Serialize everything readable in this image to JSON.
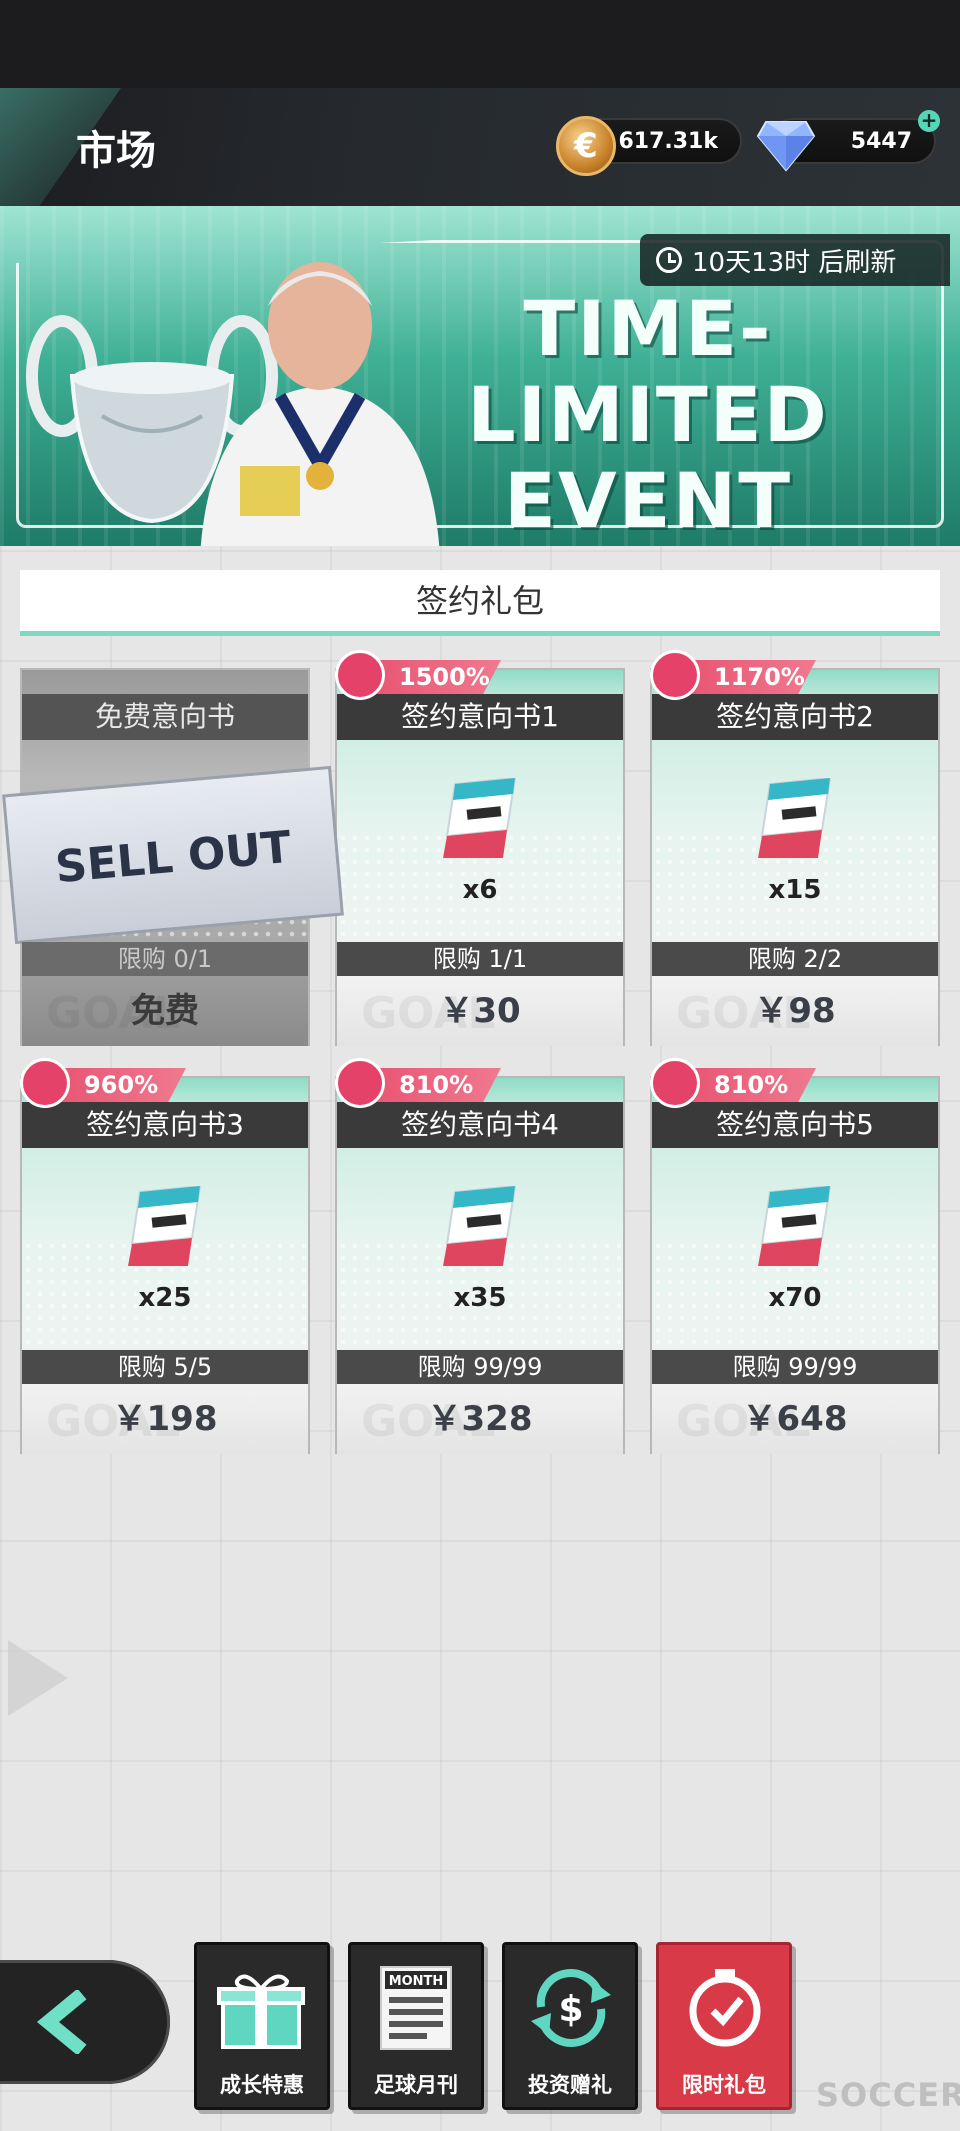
{
  "header": {
    "title": "市场",
    "coins": "617.31k",
    "coin_symbol": "€",
    "gems": "5447",
    "plus_symbol": "+"
  },
  "banner": {
    "timer": "10天13时 后刷新",
    "title_line1": "TIME-LIMITED",
    "title_line2": "EVENT"
  },
  "section": {
    "title": "签约礼包"
  },
  "packs": [
    {
      "name": "免费意向书",
      "badge": "",
      "qty": "",
      "limit": "限购 0/1",
      "price": "免费",
      "sold_out": true,
      "sold_label": "SELL OUT"
    },
    {
      "name": "签约意向书1",
      "badge": "1500%",
      "qty": "x6",
      "limit": "限购 1/1",
      "price": "￥30"
    },
    {
      "name": "签约意向书2",
      "badge": "1170%",
      "qty": "x15",
      "limit": "限购 2/2",
      "price": "￥98"
    },
    {
      "name": "签约意向书3",
      "badge": "960%",
      "qty": "x25",
      "limit": "限购 5/5",
      "price": "￥198"
    },
    {
      "name": "签约意向书4",
      "badge": "810%",
      "qty": "x35",
      "limit": "限购 99/99",
      "price": "￥328"
    },
    {
      "name": "签约意向书5",
      "badge": "810%",
      "qty": "x70",
      "limit": "限购 99/99",
      "price": "￥648"
    }
  ],
  "watermark": "GOAL",
  "nav": {
    "items": [
      {
        "label": "成长特惠",
        "icon": "gift-icon"
      },
      {
        "label": "足球月刊",
        "icon": "magazine-icon",
        "icon_text": "MONTH"
      },
      {
        "label": "投资赠礼",
        "icon": "dollar-cycle-icon",
        "icon_text": "$"
      },
      {
        "label": "限时礼包",
        "icon": "timer-icon",
        "active": true
      }
    ],
    "brand": "SOCCER"
  },
  "colors": {
    "accent": "#57d6b7",
    "badge": "#e8506f",
    "active_tab": "#d93a48"
  }
}
